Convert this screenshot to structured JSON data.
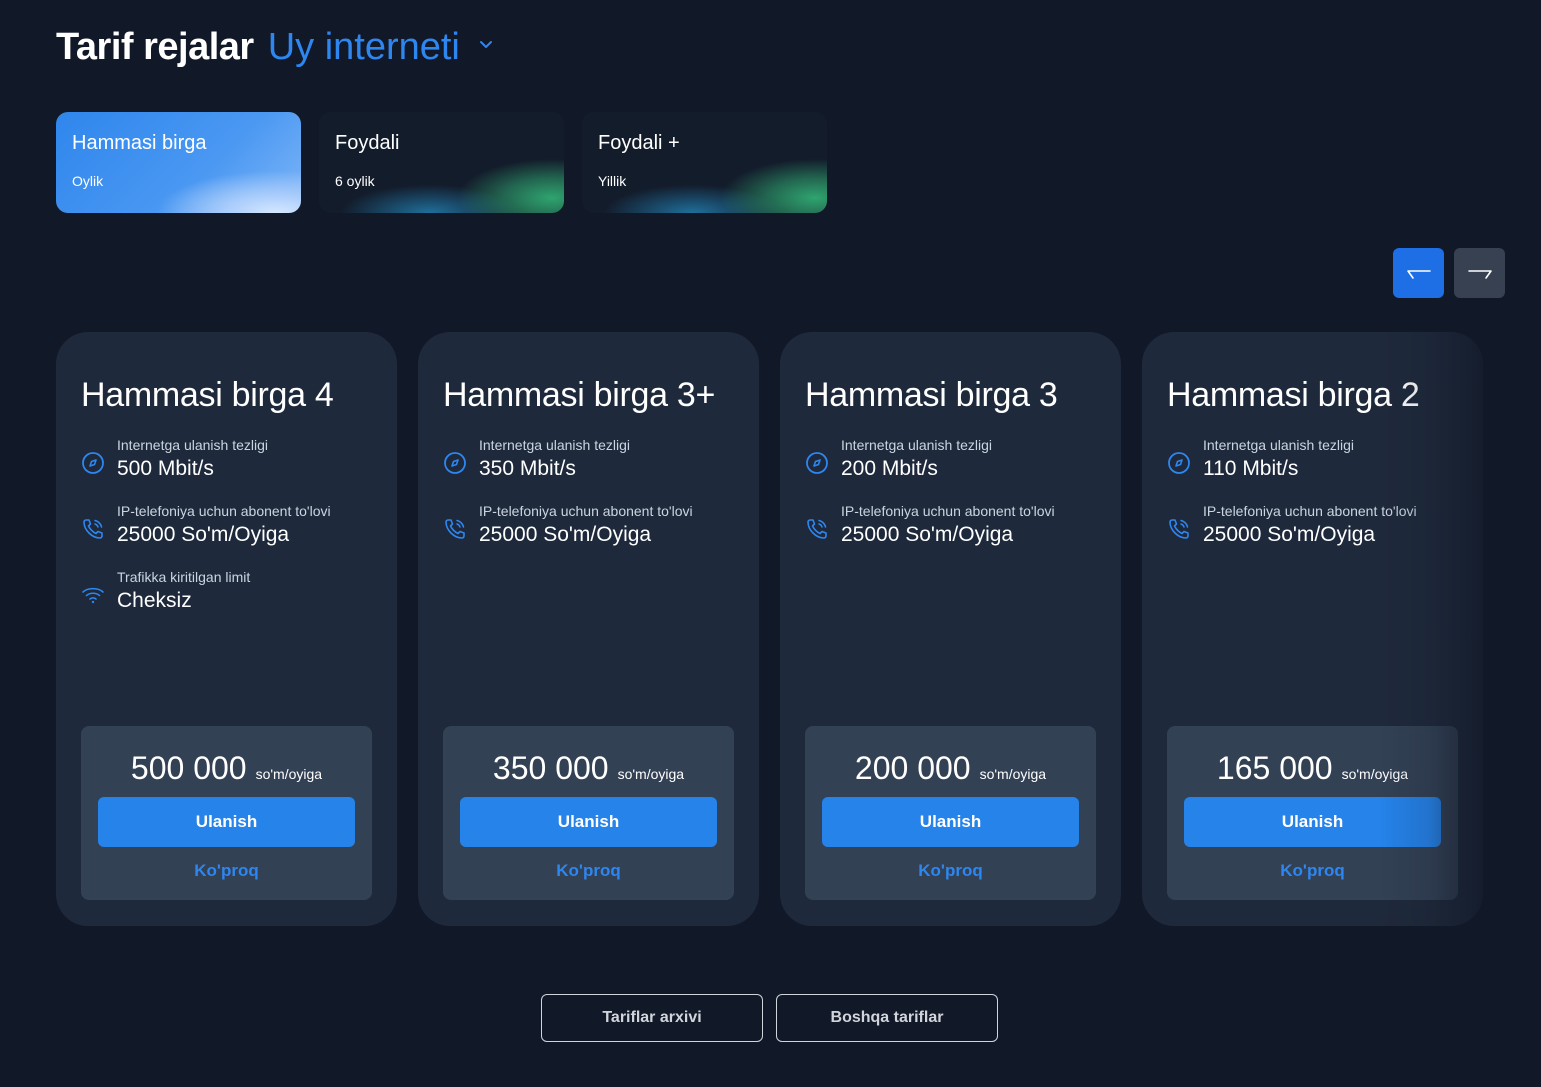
{
  "header": {
    "title": "Tarif rejalar",
    "category": "Uy interneti"
  },
  "tabs": [
    {
      "name": "Hammasi birga",
      "period": "Oylik",
      "active": true
    },
    {
      "name": "Foydali",
      "period": "6 oylik",
      "active": false
    },
    {
      "name": "Foydali +",
      "period": "Yillik",
      "active": false
    }
  ],
  "nav": {
    "prev_icon": "arrow-left-icon",
    "next_icon": "arrow-right-icon"
  },
  "cards": [
    {
      "title": "Hammasi birga 4",
      "speed_label": "Internetga ulanish tezligi",
      "speed": "500 Mbit/s",
      "phone_label": "IP-telefoniya uchun abonent to'lovi",
      "phone": "25000 So'm/Oyiga",
      "traffic_label": "Trafikka kiritilgan limit",
      "traffic": "Cheksiz",
      "price": "500 000",
      "unit": "so'm/oyiga",
      "connect": "Ulanish",
      "more": "Ko'proq"
    },
    {
      "title": "Hammasi birga 3+",
      "speed_label": "Internetga ulanish tezligi",
      "speed": "350 Mbit/s",
      "phone_label": "IP-telefoniya uchun abonent to'lovi",
      "phone": "25000 So'm/Oyiga",
      "price": "350 000",
      "unit": "so'm/oyiga",
      "connect": "Ulanish",
      "more": "Ko'proq"
    },
    {
      "title": "Hammasi birga 3",
      "speed_label": "Internetga ulanish tezligi",
      "speed": "200 Mbit/s",
      "phone_label": "IP-telefoniya uchun abonent to'lovi",
      "phone": "25000 So'm/Oyiga",
      "price": "200 000",
      "unit": "so'm/oyiga",
      "connect": "Ulanish",
      "more": "Ko'proq"
    },
    {
      "title": "Hammasi birga 2",
      "speed_label": "Internetga ulanish tezligi",
      "speed": "110 Mbit/s",
      "phone_label": "IP-telefoniya uchun abonent to'lovi",
      "phone": "25000 So'm/Oyiga",
      "price": "165 000",
      "unit": "so'm/oyiga",
      "connect": "Ulanish",
      "more": "Ko'proq"
    }
  ],
  "footer": {
    "archive_label": "Tariflar arxivi",
    "other_label": "Boshqa tariflar"
  },
  "colors": {
    "background": "#111827",
    "card": "#1e293b",
    "price_box": "#334155",
    "accent": "#2583ea"
  }
}
